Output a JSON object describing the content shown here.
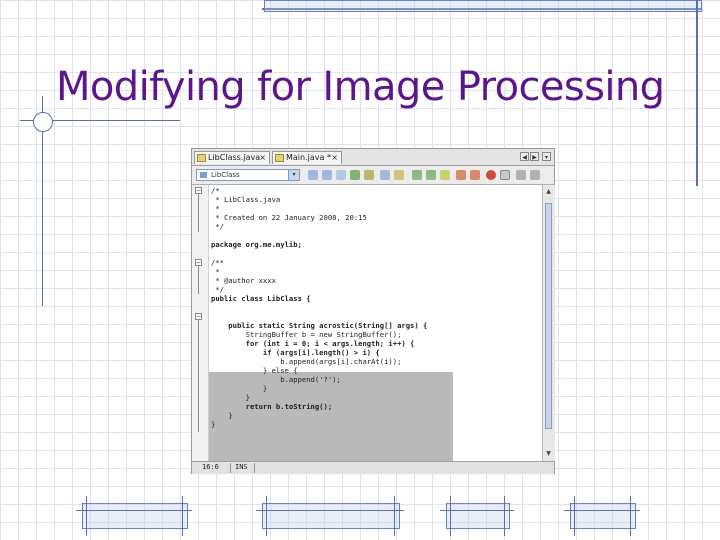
{
  "slide": {
    "title": "Modifying for Image Processing"
  },
  "editor": {
    "tabs": [
      {
        "label": "LibClass.java",
        "close": "×"
      },
      {
        "label": "Main.java *",
        "close": "×"
      }
    ],
    "nav": {
      "left": "◀",
      "right": "▶",
      "menu": "▾"
    },
    "toolbar": {
      "combo_value": "LibClass",
      "combo_drop": "▾"
    },
    "code_lines": [
      "/*",
      " * LibClass.java",
      " *",
      " * Created on 22 January 2008, 20:15",
      " */",
      "",
      "package org.me.mylib;",
      "",
      "/**",
      " *",
      " * @author xxxx",
      " */",
      "public class LibClass {",
      "",
      "    public static String acrostic(String[] args) {",
      "        StringBuffer b = new StringBuffer();",
      "        for (int i = 0; i < args.length; i++) {",
      "            if (args[i].length() > i) {",
      "                b.append(args[i].charAt(i));",
      "            } else {",
      "                b.append('?');",
      "            }",
      "        }",
      "        return b.toString();",
      "    }",
      "}"
    ],
    "fold_marks": {
      "open": "−",
      "closed": "+"
    },
    "scroll": {
      "up": "▲",
      "down": "▼"
    },
    "status": {
      "position": "16:6",
      "mode": "INS"
    },
    "colors": {
      "selection": "#b9b9b9",
      "title": "#5a168a",
      "accent": "#5b6fae"
    }
  }
}
